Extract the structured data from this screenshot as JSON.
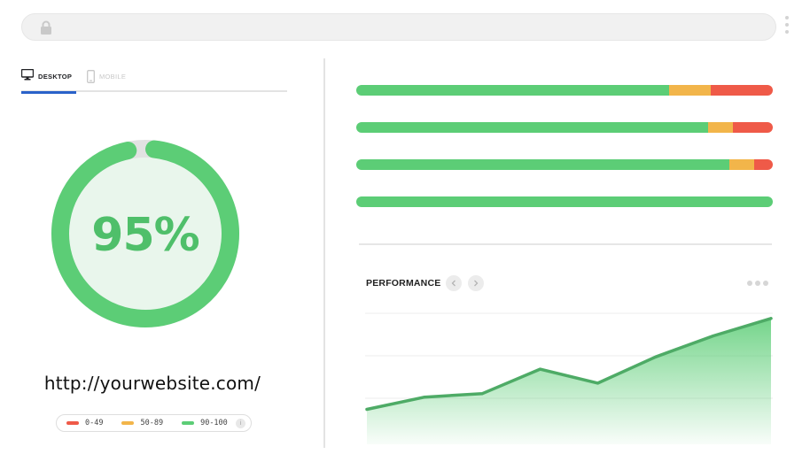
{
  "tabs": [
    {
      "label": "DESKTOP",
      "active": true
    },
    {
      "label": "MOBILE",
      "active": false
    }
  ],
  "score": {
    "value": 95,
    "label": "95%"
  },
  "url": "http://yourwebsite.com/",
  "legend": [
    {
      "label": "0-49",
      "color": "#ef5a48"
    },
    {
      "label": "50-89",
      "color": "#f2b54a"
    },
    {
      "label": "90-100",
      "color": "#5ccd76"
    }
  ],
  "legend_info_icon": "info-icon",
  "colors": {
    "good": "#5ccd76",
    "average": "#f2b54a",
    "poor": "#ef5a48",
    "accent": "#2a62c9"
  },
  "metric_bars": [
    {
      "good": 75,
      "average": 10,
      "poor": 15
    },
    {
      "good": 84.5,
      "average": 6,
      "poor": 9.5
    },
    {
      "good": 89.5,
      "average": 6,
      "poor": 4.5
    },
    {
      "good": 100,
      "average": 0,
      "poor": 0
    }
  ],
  "chart_title": "PERFORMANCE",
  "chart_data": {
    "type": "area",
    "title": "PERFORMANCE",
    "xlabel": "",
    "ylabel": "",
    "x": [
      0,
      1,
      2,
      3,
      4,
      5,
      6,
      7
    ],
    "series": [
      {
        "values": [
          20,
          27,
          29,
          43,
          35,
          50,
          62,
          72
        ]
      }
    ],
    "ylim": [
      0,
      80
    ],
    "grid": true,
    "color": "#5ccd76"
  }
}
